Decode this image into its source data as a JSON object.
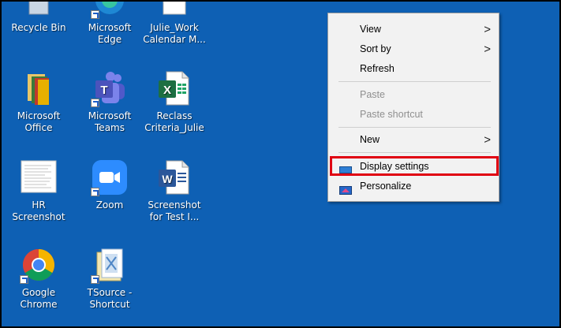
{
  "desktop": {
    "background_color": "#0e60b4",
    "icons": [
      {
        "label": "Recycle Bin",
        "icon": "recycle-bin-icon"
      },
      {
        "label": "Microsoft\nEdge",
        "icon": "edge-icon"
      },
      {
        "label": "Julie_Work\nCalendar M...",
        "icon": "document-icon"
      },
      {
        "label": "Microsoft\nOffice",
        "icon": "office-folder-icon"
      },
      {
        "label": "Microsoft\nTeams",
        "icon": "teams-icon"
      },
      {
        "label": "Reclass\nCriteria_Julie",
        "icon": "excel-icon"
      },
      {
        "label": "HR\nScreenshot",
        "icon": "screenshot-document-icon"
      },
      {
        "label": "Zoom",
        "icon": "zoom-icon"
      },
      {
        "label": "Screenshot\nfor Test I...",
        "icon": "word-icon"
      },
      {
        "label": "Google\nChrome",
        "icon": "chrome-icon"
      },
      {
        "label": "TSource -\nShortcut",
        "icon": "tsource-folder-icon"
      }
    ]
  },
  "context_menu": {
    "view": "View",
    "sort_by": "Sort by",
    "refresh": "Refresh",
    "paste": "Paste",
    "paste_shortcut": "Paste shortcut",
    "new": "New",
    "display_settings": "Display settings",
    "personalize": "Personalize",
    "submenu_chevron": ">"
  },
  "highlight_color": "#e00012"
}
